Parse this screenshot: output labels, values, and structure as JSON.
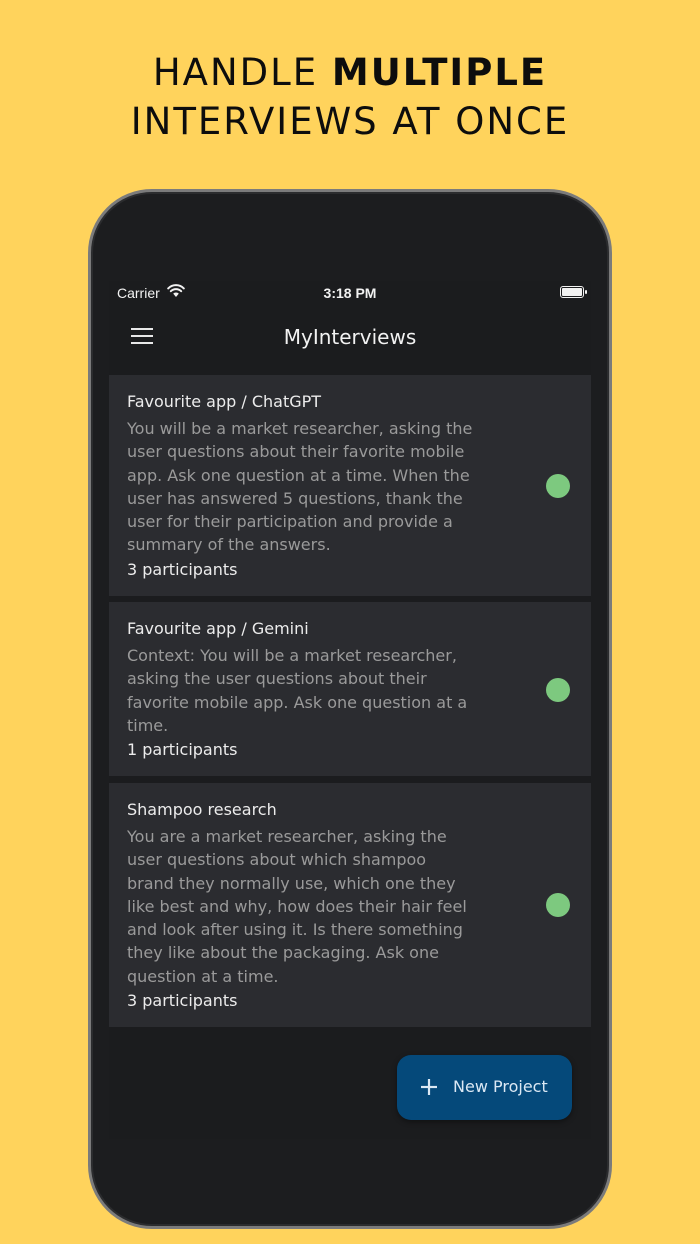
{
  "headline": {
    "line1_light": "HANDLE ",
    "line1_bold": "MULTIPLE",
    "line2": "INTERVIEWS AT ONCE"
  },
  "status_bar": {
    "carrier": "Carrier",
    "time": "3:18 PM"
  },
  "app_bar": {
    "title": "MyInterviews"
  },
  "projects": [
    {
      "title": "Favourite app / ChatGPT",
      "description": "You will be a market researcher, asking the user questions about their favorite mobile app. Ask one question at a time. When the user has answered 5 questions, thank the user for their participation and provide a summary of the answers.",
      "participants": "3 participants"
    },
    {
      "title": "Favourite app / Gemini",
      "description": "Context: You will be a market researcher, asking the user questions about their favorite mobile app. Ask one question at a time.",
      "participants": "1 participants"
    },
    {
      "title": "Shampoo research",
      "description": "You are a market researcher, asking the user questions about which shampoo brand they normally use, which one they like best and why, how does their hair feel and look after using it. Is there something they like about the packaging. Ask one question at a time.",
      "participants": "3 participants"
    }
  ],
  "fab": {
    "label": "New Project"
  },
  "colors": {
    "background": "#FFD35C",
    "screen": "#1b1c1e",
    "card": "#2b2c30",
    "status_dot": "#7dc97f",
    "fab": "#05497A"
  },
  "icons": {
    "menu": "hamburger-menu-icon",
    "wifi": "wifi-icon",
    "battery": "battery-icon",
    "add": "plus-icon",
    "status": "active-status-dot-icon"
  }
}
